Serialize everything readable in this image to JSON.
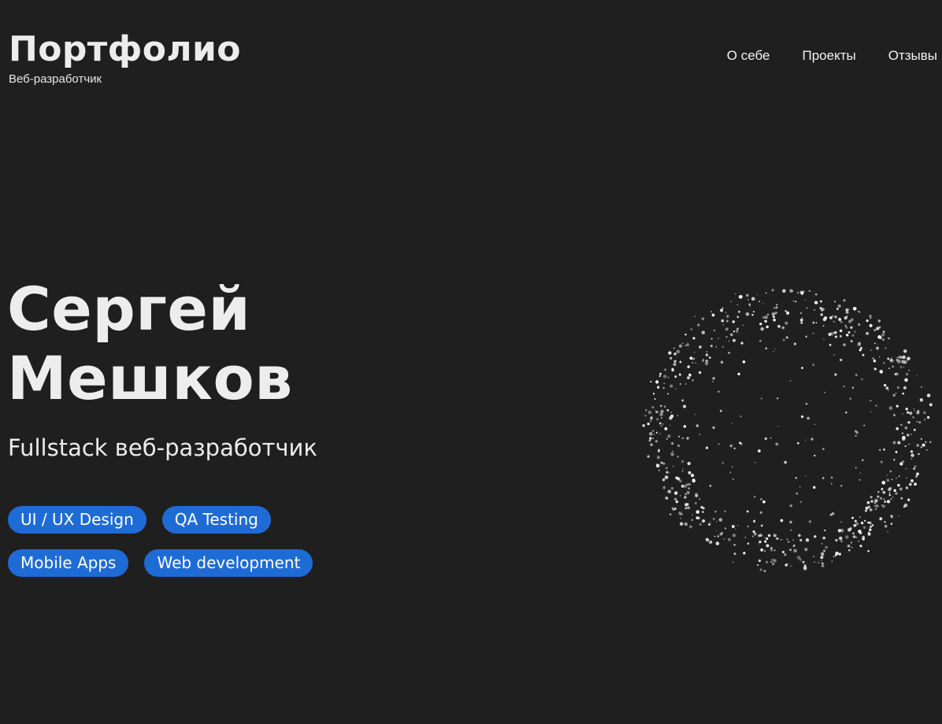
{
  "header": {
    "brand_title": "Портфолио",
    "brand_subtitle": "Веб-разработчик",
    "nav_items": [
      {
        "label": "О себе"
      },
      {
        "label": "Проекты"
      },
      {
        "label": "Отзывы"
      }
    ]
  },
  "hero": {
    "first_name": "Сергей",
    "last_name": "Мешков",
    "role": "Fullstack веб-разработчик",
    "tags": [
      {
        "label": "UI / UX Design"
      },
      {
        "label": "QA Testing"
      },
      {
        "label": "Mobile Apps"
      },
      {
        "label": "Web development"
      }
    ]
  },
  "colors": {
    "background": "#1f1f1f",
    "accent": "#1f6bd6",
    "text": "#f1f1f1",
    "particles": "#ffffff"
  },
  "icons": {
    "hero_visual": "particle-sphere-icon"
  }
}
